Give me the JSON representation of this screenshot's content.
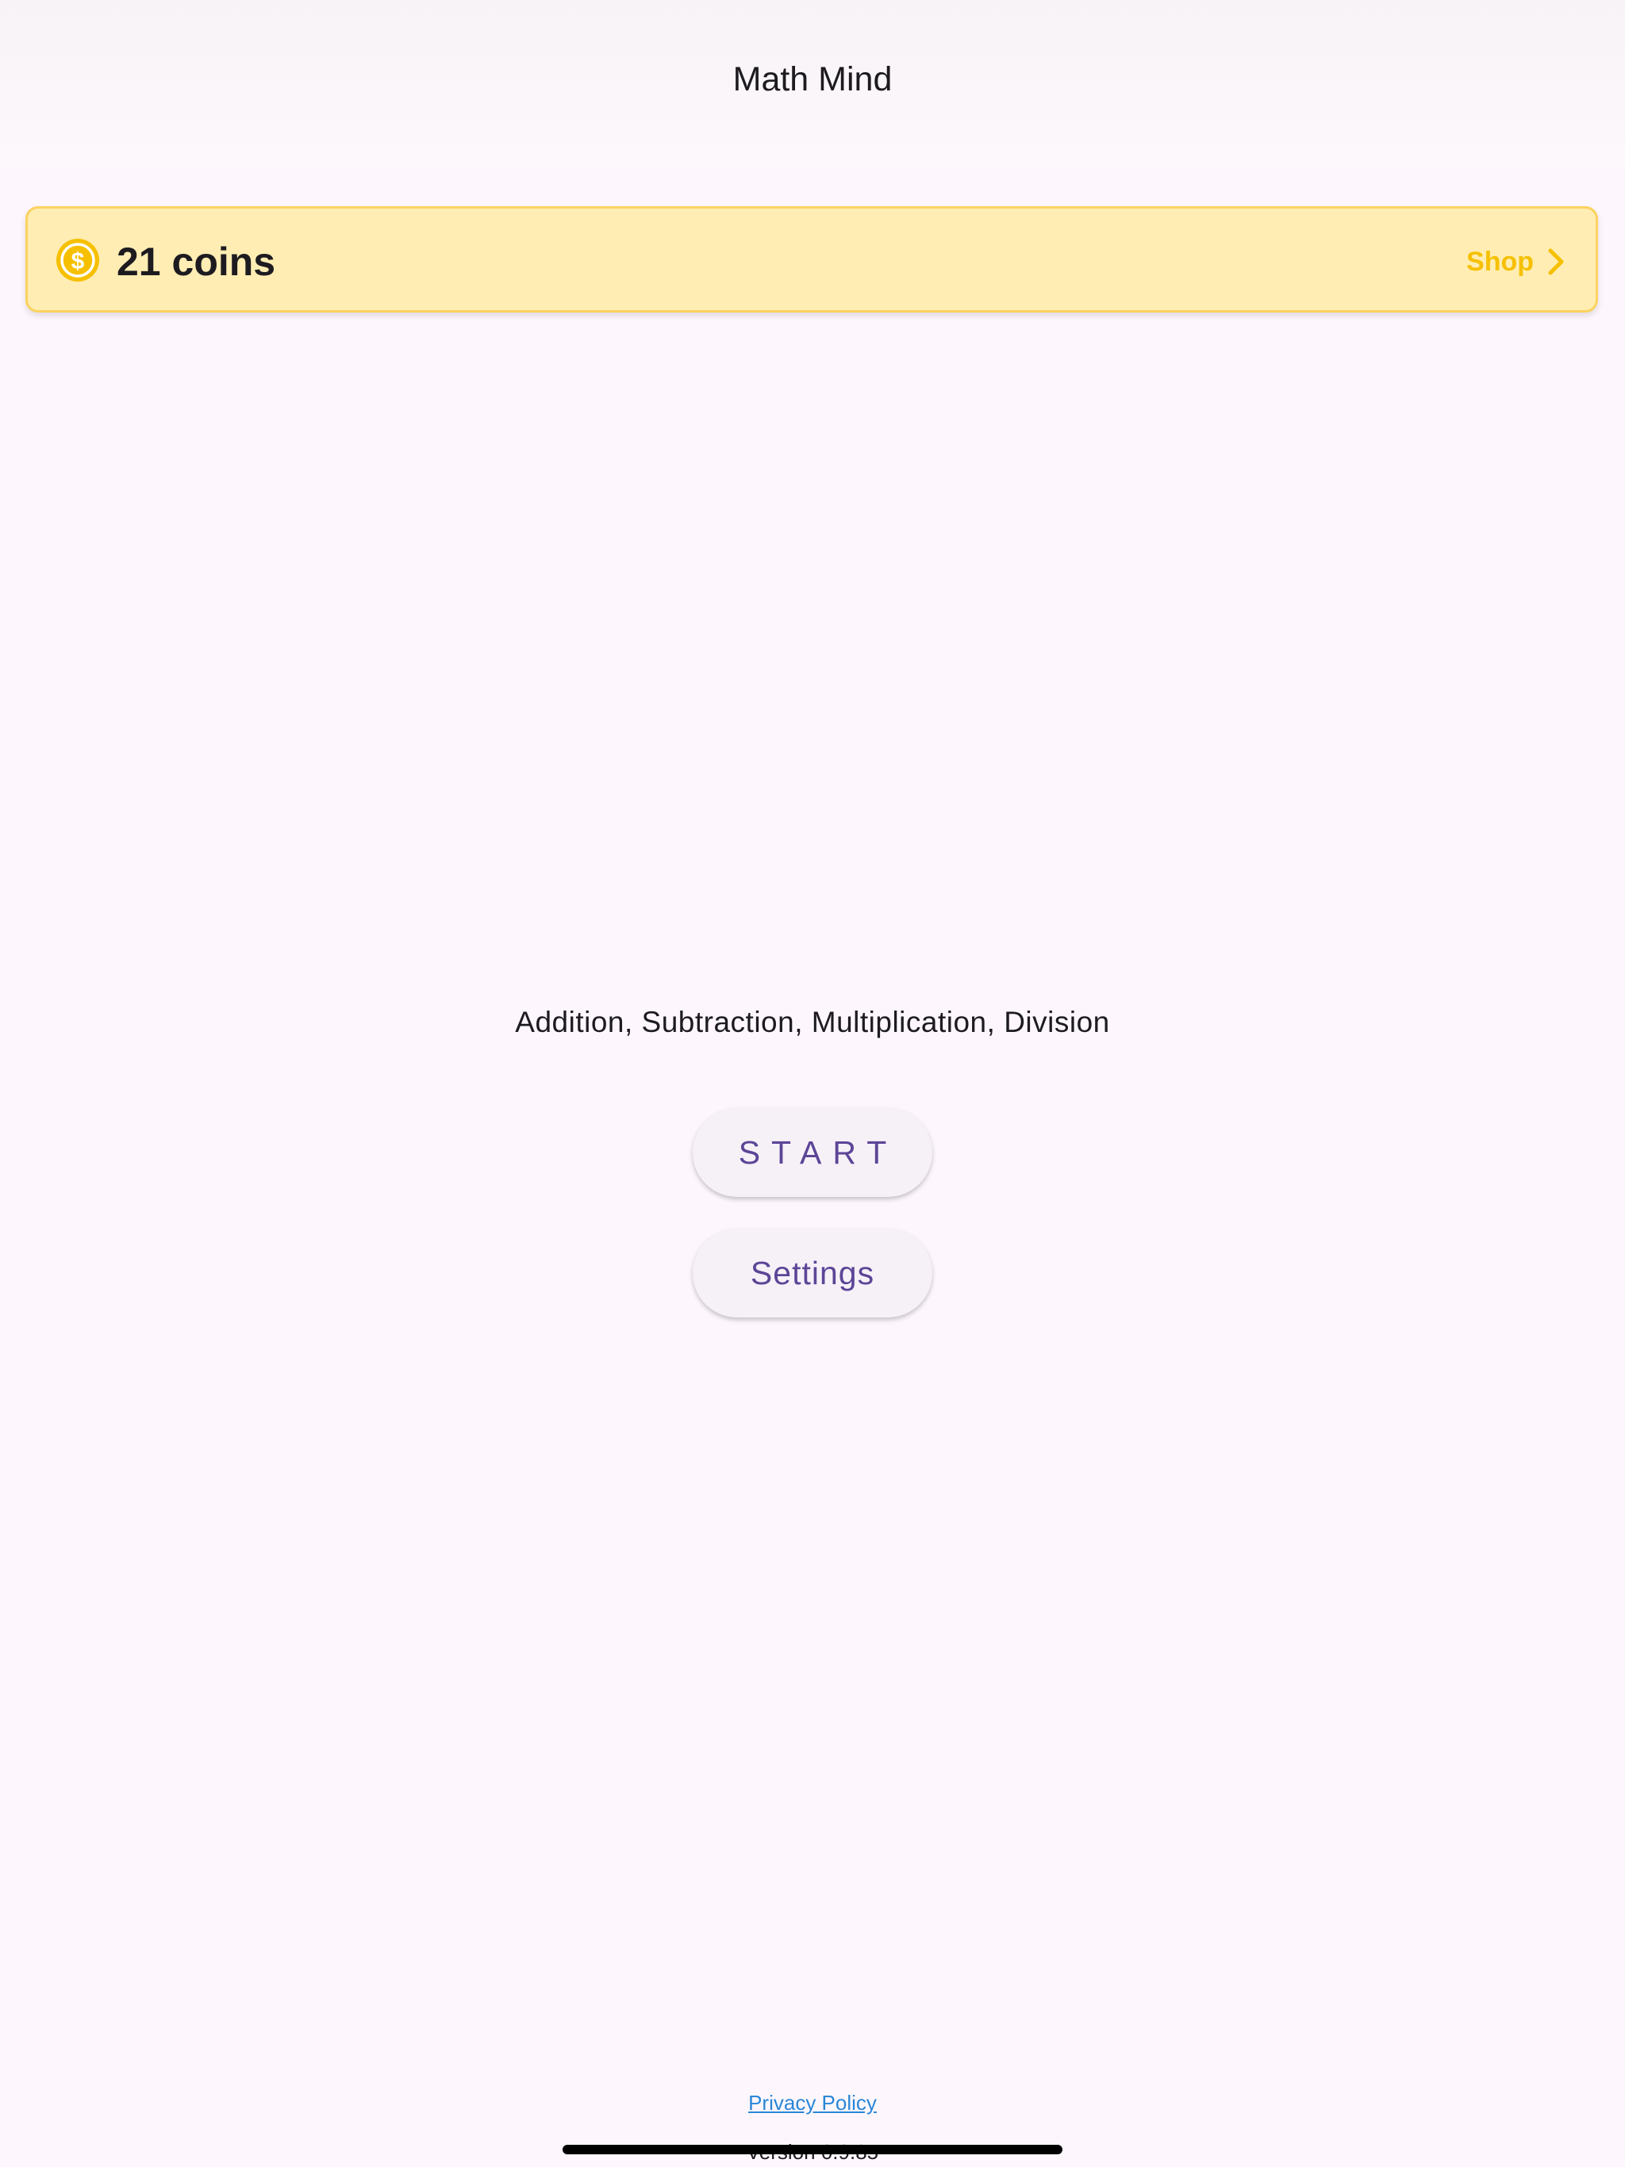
{
  "app_bar": {
    "title": "Math Mind"
  },
  "coins_card": {
    "icon": "dollar-coin-icon",
    "coins_label": "21 coins",
    "shop_label": "Shop",
    "shop_icon": "chevron-right-icon",
    "colors": {
      "background": "#ffedb3",
      "border": "#fcd35f",
      "accent": "#f6c000"
    }
  },
  "main": {
    "modes_text": "Addition, Subtraction, Multiplication, Division",
    "start_label": "START",
    "settings_label": "Settings",
    "button_text_color": "#5c4597"
  },
  "footer": {
    "privacy_label": "Privacy Policy",
    "version_label": "Version 0.9.85"
  }
}
